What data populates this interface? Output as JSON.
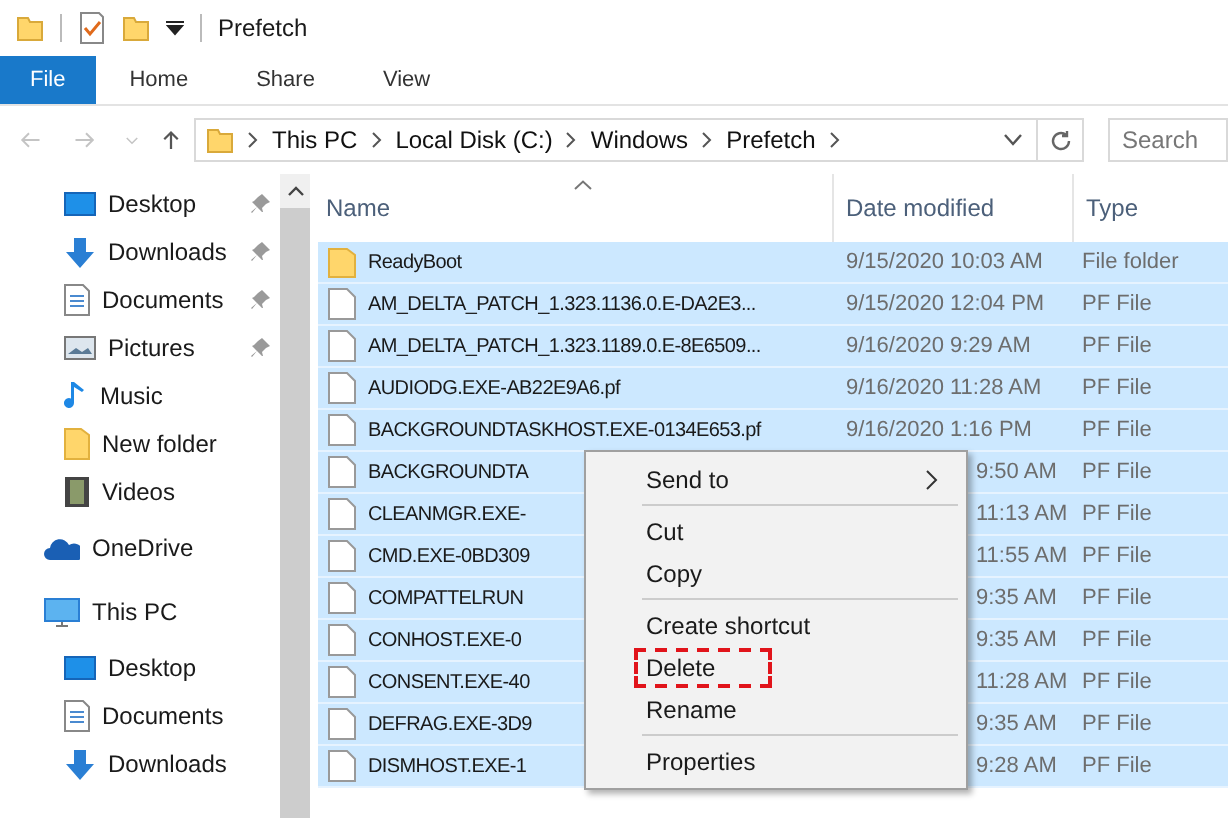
{
  "window": {
    "title": "Prefetch"
  },
  "ribbon_tabs": [
    {
      "label": "File",
      "selected": true
    },
    {
      "label": "Home",
      "selected": false
    },
    {
      "label": "Share",
      "selected": false
    },
    {
      "label": "View",
      "selected": false
    }
  ],
  "address_bar": {
    "crumbs": [
      "This PC",
      "Local Disk (C:)",
      "Windows",
      "Prefetch"
    ]
  },
  "search": {
    "placeholder": "Search"
  },
  "sidebar": {
    "quick_access": [
      {
        "label": "Desktop",
        "kind": "desktop",
        "pinned": true
      },
      {
        "label": "Downloads",
        "kind": "downloads",
        "pinned": true
      },
      {
        "label": "Documents",
        "kind": "documents",
        "pinned": true
      },
      {
        "label": "Pictures",
        "kind": "pictures",
        "pinned": true
      },
      {
        "label": "Music",
        "kind": "music",
        "pinned": false
      },
      {
        "label": "New folder",
        "kind": "folder",
        "pinned": false
      },
      {
        "label": "Videos",
        "kind": "videos",
        "pinned": false
      }
    ],
    "locations": [
      {
        "label": "OneDrive",
        "kind": "onedrive"
      },
      {
        "label": "This PC",
        "kind": "pc",
        "children": [
          {
            "label": "Desktop",
            "kind": "desktop"
          },
          {
            "label": "Documents",
            "kind": "documents"
          },
          {
            "label": "Downloads",
            "kind": "downloads"
          }
        ]
      }
    ]
  },
  "table": {
    "columns": [
      {
        "label": "Name",
        "sorted": true
      },
      {
        "label": "Date modified",
        "sorted": false
      },
      {
        "label": "Type",
        "sorted": false
      }
    ],
    "rows": [
      {
        "name": "ReadyBoot",
        "date": "9/15/2020 10:03 AM",
        "type": "File folder",
        "kind": "folder",
        "selected": true,
        "covered": false
      },
      {
        "name": "AM_DELTA_PATCH_1.323.1136.0.E-DA2E3...",
        "date": "9/15/2020 12:04 PM",
        "type": "PF File",
        "kind": "file",
        "selected": true,
        "covered": false
      },
      {
        "name": "AM_DELTA_PATCH_1.323.1189.0.E-8E6509...",
        "date": "9/16/2020 9:29 AM",
        "type": "PF File",
        "kind": "file",
        "selected": true,
        "covered": false
      },
      {
        "name": "AUDIODG.EXE-AB22E9A6.pf",
        "date": "9/16/2020 11:28 AM",
        "type": "PF File",
        "kind": "file",
        "selected": true,
        "covered": false
      },
      {
        "name": "BACKGROUNDTASKHOST.EXE-0134E653.pf",
        "date": "9/16/2020 1:16 PM",
        "type": "PF File",
        "kind": "file",
        "selected": true,
        "covered": false
      },
      {
        "name": "BACKGROUNDTA",
        "date": "9:50 AM",
        "type": "PF File",
        "kind": "file",
        "selected": true,
        "covered": true
      },
      {
        "name": "CLEANMGR.EXE-",
        "date": "11:13 AM",
        "type": "PF File",
        "kind": "file",
        "selected": true,
        "covered": true
      },
      {
        "name": "CMD.EXE-0BD309",
        "date": "11:55 AM",
        "type": "PF File",
        "kind": "file",
        "selected": true,
        "covered": true
      },
      {
        "name": "COMPATTELRUN",
        "date": "9:35 AM",
        "type": "PF File",
        "kind": "file",
        "selected": true,
        "covered": true
      },
      {
        "name": "CONHOST.EXE-0",
        "date": "9:35 AM",
        "type": "PF File",
        "kind": "file",
        "selected": true,
        "covered": true
      },
      {
        "name": "CONSENT.EXE-40",
        "date": "11:28 AM",
        "type": "PF File",
        "kind": "file",
        "selected": true,
        "covered": true
      },
      {
        "name": "DEFRAG.EXE-3D9",
        "date": "9:35 AM",
        "type": "PF File",
        "kind": "file",
        "selected": true,
        "covered": true
      },
      {
        "name": "DISMHOST.EXE-1",
        "date": "9:28 AM",
        "type": "PF File",
        "kind": "file",
        "selected": true,
        "covered": true
      }
    ]
  },
  "context_menu": {
    "items": [
      {
        "kind": "item",
        "label": "Send to",
        "submenu": true,
        "highlighted": false
      },
      {
        "kind": "separator"
      },
      {
        "kind": "item",
        "label": "Cut",
        "submenu": false,
        "highlighted": false
      },
      {
        "kind": "item",
        "label": "Copy",
        "submenu": false,
        "highlighted": false
      },
      {
        "kind": "separator"
      },
      {
        "kind": "item",
        "label": "Create shortcut",
        "submenu": false,
        "highlighted": false
      },
      {
        "kind": "item",
        "label": "Delete",
        "submenu": false,
        "highlighted": true
      },
      {
        "kind": "item",
        "label": "Rename",
        "submenu": false,
        "highlighted": false
      },
      {
        "kind": "separator"
      },
      {
        "kind": "item",
        "label": "Properties",
        "submenu": false,
        "highlighted": false
      }
    ]
  }
}
